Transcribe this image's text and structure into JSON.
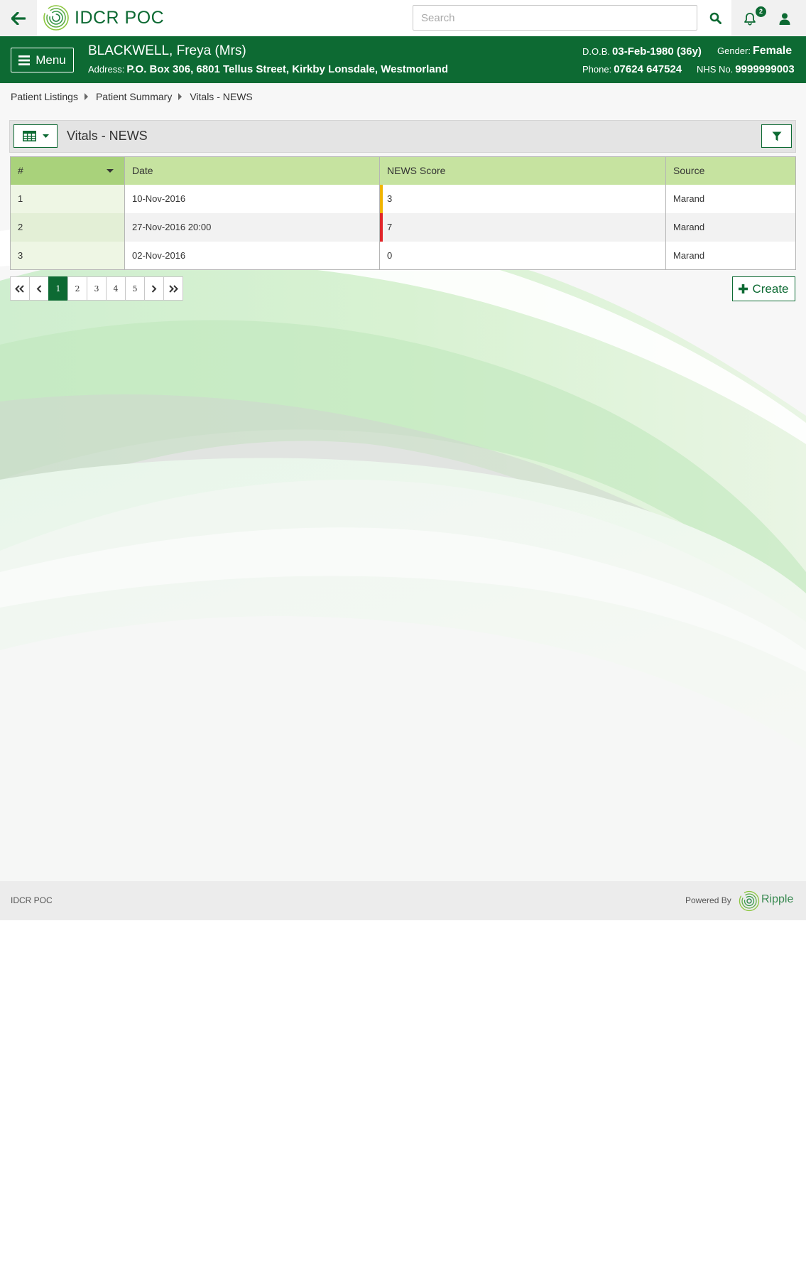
{
  "topbar": {
    "app_title": "IDCR POC",
    "search_placeholder": "Search",
    "notification_count": "2"
  },
  "patient": {
    "name": "BLACKWELL, Freya (Mrs)",
    "address_label": "Address:",
    "address": "P.O. Box 306, 6801 Tellus Street, Kirkby Lonsdale, Westmorland",
    "dob_label": "D.O.B.",
    "dob": "03-Feb-1980 (36y)",
    "gender_label": "Gender:",
    "gender": "Female",
    "phone_label": "Phone:",
    "phone": "07624 647524",
    "nhs_label": "NHS No.",
    "nhs": "9999999003",
    "menu_label": "Menu"
  },
  "breadcrumb": {
    "items": [
      "Patient Listings",
      "Patient Summary",
      "Vitals - NEWS"
    ]
  },
  "panel": {
    "title": "Vitals - NEWS"
  },
  "table": {
    "headers": [
      "#",
      "Date",
      "NEWS Score",
      "Source"
    ],
    "rows": [
      {
        "index": "1",
        "date": "10-Nov-2016",
        "score": "3",
        "source": "Marand",
        "score_color": "#f0b400"
      },
      {
        "index": "2",
        "date": "27-Nov-2016 20:00",
        "score": "7",
        "source": "Marand",
        "score_color": "#e0262a"
      },
      {
        "index": "3",
        "date": "02-Nov-2016",
        "score": "0",
        "source": "Marand",
        "score_color": ""
      }
    ]
  },
  "pagination": {
    "pages": [
      "1",
      "2",
      "3",
      "4",
      "5"
    ],
    "active_page": "1"
  },
  "actions": {
    "create_label": "Create"
  },
  "footer": {
    "left_text": "IDCR POC",
    "powered_by": "Powered By",
    "brand": "Ripple"
  },
  "colors": {
    "brand_green": "#0d6a33",
    "header_green": "#c6e3a0",
    "amber": "#f0b400",
    "red": "#e0262a"
  }
}
